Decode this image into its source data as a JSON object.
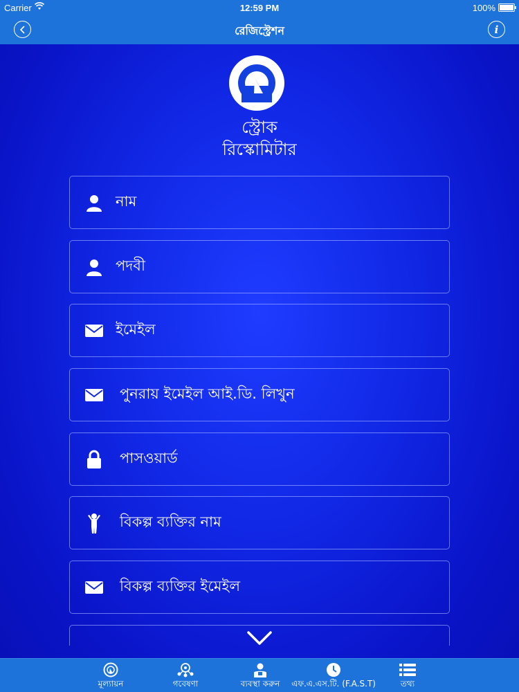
{
  "status_bar": {
    "carrier": "Carrier",
    "time": "12:59 PM",
    "battery": "100%"
  },
  "nav": {
    "title": "রেজিস্ট্রেশন",
    "back_icon": "chevron-left-icon",
    "info_icon": "info-icon"
  },
  "app": {
    "name_line1": "স্ট্রোক",
    "name_line2": "রিস্কোমিটার",
    "logo_icon": "gauge-icon"
  },
  "form": {
    "fields": [
      {
        "label": "নাম",
        "icon": "person-icon"
      },
      {
        "label": "পদবী",
        "icon": "person-icon"
      },
      {
        "label": "ইমেইল",
        "icon": "envelope-icon"
      },
      {
        "label": "পুনরায় ইমেইল আই.ডি. লিখুন",
        "icon": "envelope-icon"
      },
      {
        "label": "পাসওয়ার্ড",
        "icon": "lock-icon"
      },
      {
        "label": "বিকল্প ব্যক্তির নাম",
        "icon": "person-arms-up-icon"
      },
      {
        "label": "বিকল্প ব্যক্তির ইমেইল",
        "icon": "envelope-icon"
      }
    ]
  },
  "tabs": [
    {
      "label": "মূল্যায়ন",
      "icon": "gauge-icon"
    },
    {
      "label": "গবেষণা",
      "icon": "research-icon"
    },
    {
      "label": "ব্যবস্থা করুন",
      "icon": "manage-icon"
    },
    {
      "label": "এফ.এ.এস.টি. (F.A.S.T)",
      "icon": "clock-icon"
    },
    {
      "label": "তথ্য",
      "icon": "list-icon"
    }
  ],
  "colors": {
    "bar": "#1d73d9",
    "background": "#1128e6",
    "text": "#ffffff"
  }
}
